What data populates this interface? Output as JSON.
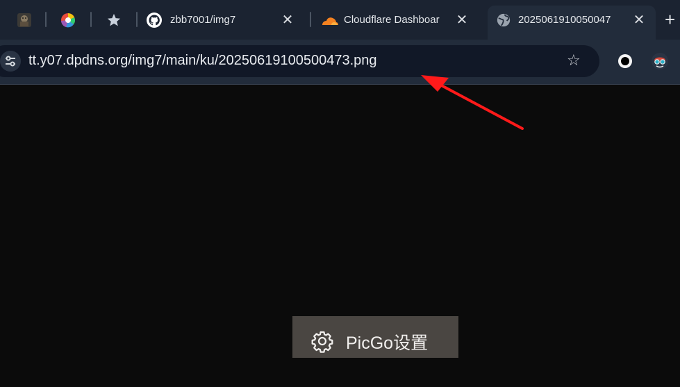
{
  "tabs": [
    {
      "title": "",
      "icon": "game-character-icon"
    },
    {
      "title": "",
      "icon": "color-wheel-icon"
    },
    {
      "title": "",
      "icon": "star-icon"
    },
    {
      "title": "zbb7001/img7",
      "icon": "github-icon"
    },
    {
      "title": "Cloudflare Dashboar",
      "icon": "cloudflare-icon"
    },
    {
      "title": "2025061910050047",
      "icon": "globe-icon",
      "active": true
    }
  ],
  "address_bar": {
    "url": "tt.y07.dpdns.org/img7/main/ku/20250619100500473.png"
  },
  "picgo": {
    "label": "PicGo设置"
  },
  "colors": {
    "tabstrip": "#1b2331",
    "toolbar": "#222c3b",
    "omnibox": "#111827",
    "page_bg": "#0b0b0b",
    "arrow": "#ff1a1a",
    "picgo_bg": "#4a4642"
  }
}
